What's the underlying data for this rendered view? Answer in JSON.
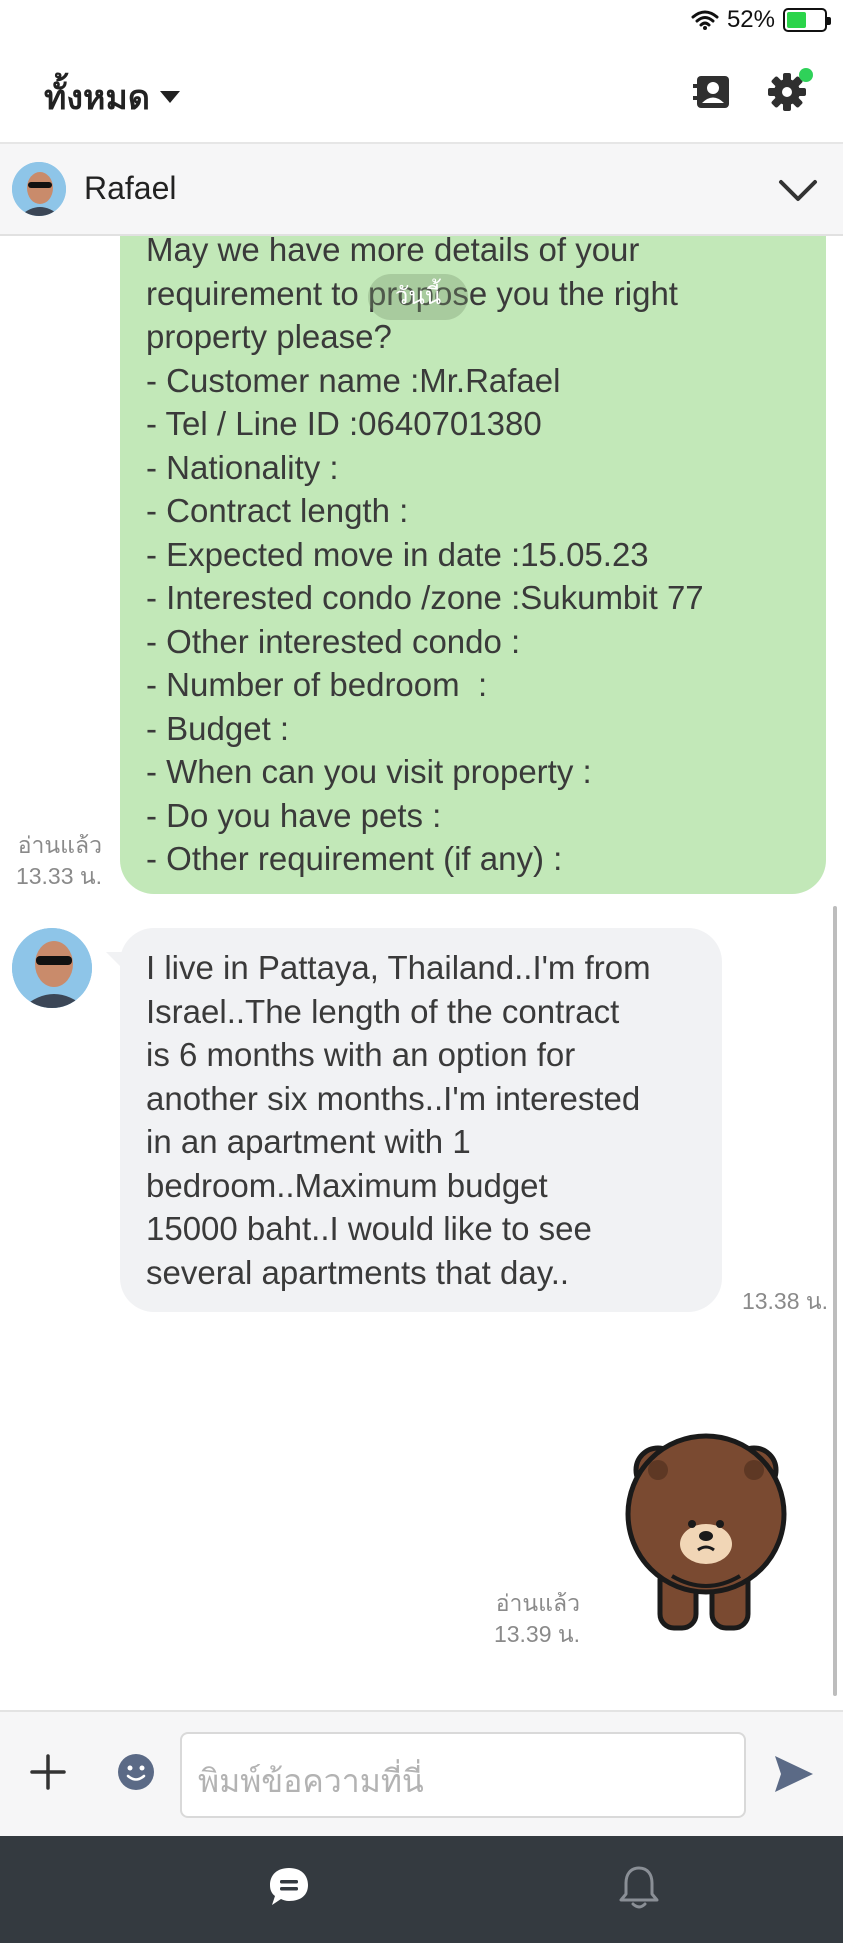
{
  "status": {
    "battery": "52%",
    "battery_level": 0.52,
    "battery_color": "#2bd44a"
  },
  "header": {
    "title": "ทั้งหมด"
  },
  "chat": {
    "contact_name": "Rafael"
  },
  "day_badge": "วันนี้",
  "messages": {
    "outgoing_1": {
      "lines": [
        "May we have more details of your",
        "requirement to propose you the right",
        "property please?",
        "- Customer name :Mr.Rafael",
        "- Tel / Line ID :0640701380",
        "- Nationality :",
        "- Contract length :",
        "- Expected move in date :15.05.23",
        "- Interested condo /zone :Sukumbit 77",
        "- Other interested condo :",
        "- Number of bedroom  :",
        "- Budget :",
        "- When can you visit property :",
        "- Do you have pets :",
        "- Other requirement (if any) :"
      ],
      "read": "อ่านแล้ว",
      "time": "13.33 น."
    },
    "incoming_1": {
      "lines": [
        "I live in Pattaya, Thailand..I'm from",
        "Israel..The length of the contract",
        "is 6 months with an option for",
        "another six months..I'm interested",
        "in an apartment with 1",
        "bedroom..Maximum budget",
        "15000 baht..I would like to see",
        "several apartments that day.."
      ],
      "time": "13.38 น."
    },
    "sticker_1": {
      "read": "อ่านแล้ว",
      "time": "13.39 น."
    }
  },
  "composer": {
    "placeholder": "พิมพ์ข้อความที่นี่"
  },
  "colors": {
    "outgoing_bubble": "#c2e8b8",
    "incoming_bubble": "#f1f2f4",
    "nav_bg": "#343a40"
  }
}
